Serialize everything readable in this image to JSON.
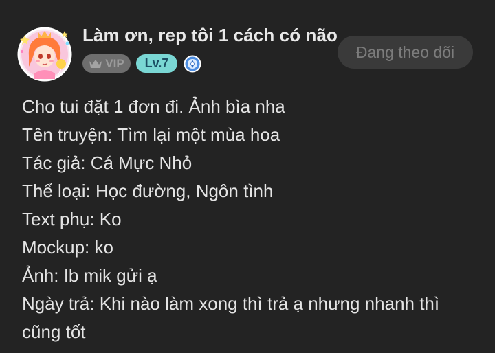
{
  "post": {
    "author": {
      "username": "Làm ơn, rep tôi 1 cách có não",
      "badges": {
        "vip_label": "VIP",
        "vip_icon": "crown-icon",
        "level_label": "Lv.7",
        "medal_icon": "blue-medal-icon"
      },
      "avatar_icon": "anime-girl-avatar"
    },
    "follow_button_label": "Đang theo dõi",
    "content_lines": [
      "Cho tui đặt 1 đơn đi. Ảnh bìa nha",
      "Tên truyện: Tìm lại một mùa hoa",
      "Tác giả: Cá Mực Nhỏ",
      "Thể loại: Học đường, Ngôn tình",
      "Text phụ: Ko",
      "Mockup: ko",
      "Ảnh: Ib mik gửi ạ",
      "Ngày trả: Khi nào làm xong thì trả ạ nhưng nhanh thì",
      "cũng tốt"
    ]
  },
  "colors": {
    "background": "#232323",
    "text": "#e4e4e4",
    "level_badge": "#7ad7d4",
    "vip_badge": "#6e6e6e",
    "follow_button_bg": "#3a3a3a",
    "follow_button_text": "#7c7c7c"
  }
}
